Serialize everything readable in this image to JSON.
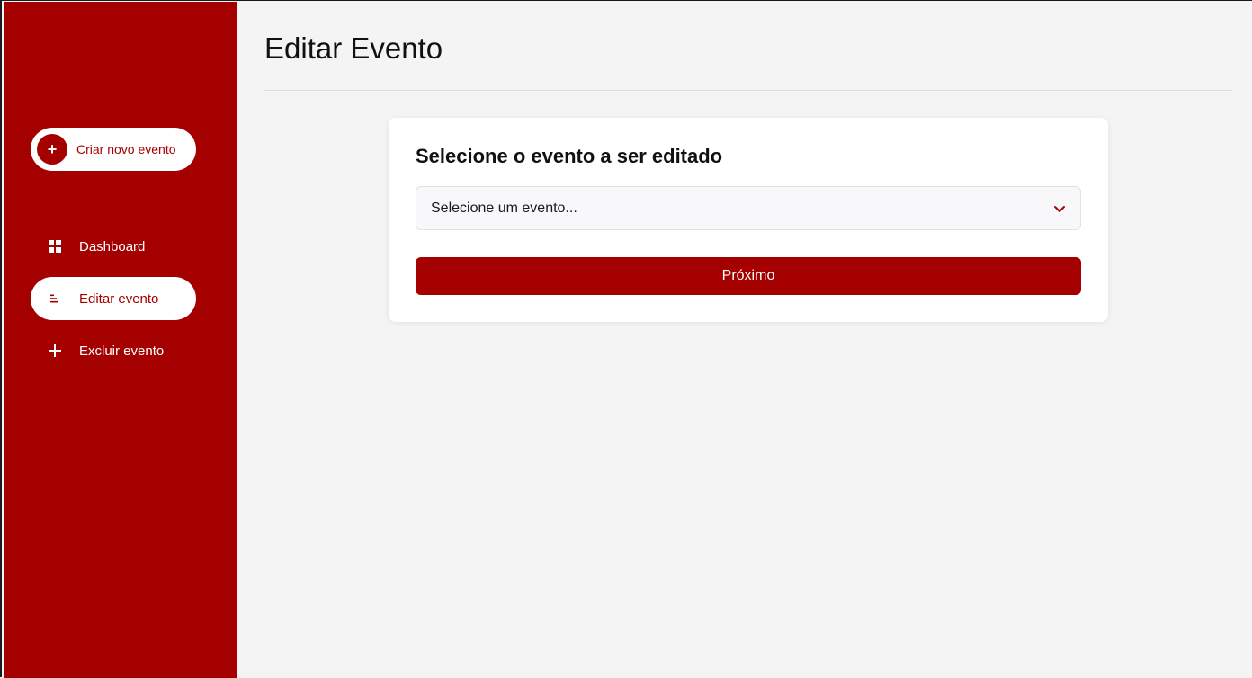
{
  "sidebar": {
    "create_button_label": "Criar novo evento",
    "items": [
      {
        "label": "Dashboard",
        "icon": "grid-icon"
      },
      {
        "label": "Editar evento",
        "icon": "list-icon",
        "active": true
      },
      {
        "label": "Excluir evento",
        "icon": "plus-icon"
      }
    ]
  },
  "main": {
    "title": "Editar Evento",
    "card": {
      "title": "Selecione o evento a ser editado",
      "select_value": "Selecione um evento...",
      "next_label": "Próximo"
    }
  },
  "colors": {
    "brand": "#a50000",
    "background": "#f4f4f4",
    "card": "#ffffff"
  }
}
